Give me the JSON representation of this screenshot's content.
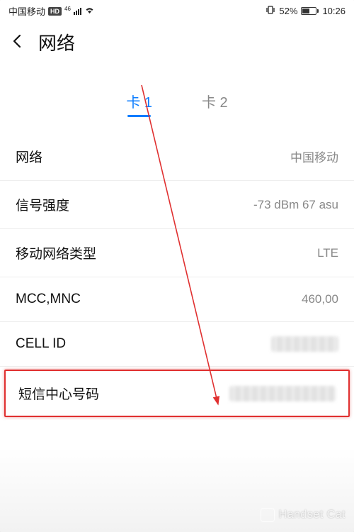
{
  "status": {
    "carrier": "中国移动",
    "hd": "HD",
    "net_gen": "46",
    "battery_pct": "52%",
    "time": "10:26"
  },
  "header": {
    "title": "网络"
  },
  "tabs": {
    "sim1": "卡 1",
    "sim2": "卡 2"
  },
  "rows": {
    "network": {
      "label": "网络",
      "value": "中国移动"
    },
    "signal": {
      "label": "信号强度",
      "value": "-73 dBm   67 asu"
    },
    "nettype": {
      "label": "移动网络类型",
      "value": "LTE"
    },
    "mccmnc": {
      "label": "MCC,MNC",
      "value": "460,00"
    },
    "cellid": {
      "label": "CELL ID"
    },
    "smsc": {
      "label": "短信中心号码"
    }
  },
  "watermark": "Handset Cat"
}
